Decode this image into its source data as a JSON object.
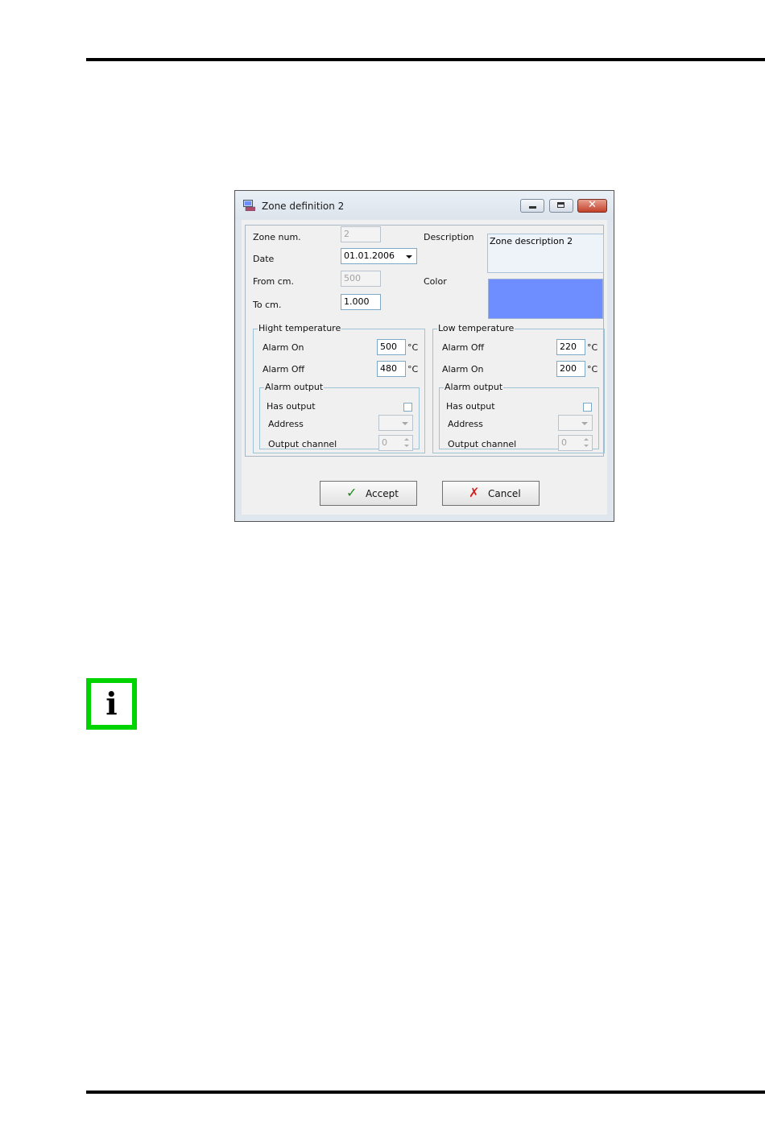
{
  "dialog": {
    "title": "Zone definition 2",
    "close_glyph": "✕",
    "zone_num_label": "Zone num.",
    "zone_num_value": "2",
    "date_label": "Date",
    "date_value": "01.01.2006",
    "from_label": "From cm.",
    "from_value": "500",
    "to_label": "To cm.",
    "to_value": "1.000",
    "description_label": "Description",
    "description_value": "Zone description 2",
    "color_label": "Color",
    "color_value": "#6e8dff",
    "high": {
      "title": "Hight temperature",
      "alarm1_label": "Alarm On",
      "alarm1_value": "500",
      "alarm2_label": "Alarm Off",
      "alarm2_value": "480",
      "unit": "°C",
      "output": {
        "title": "Alarm output",
        "has_output_label": "Has output",
        "address_label": "Address",
        "address_value": "",
        "channel_label": "Output channel",
        "channel_value": "0"
      }
    },
    "low": {
      "title": "Low temperature",
      "alarm1_label": "Alarm Off",
      "alarm1_value": "220",
      "alarm2_label": "Alarm On",
      "alarm2_value": "200",
      "unit": "°C",
      "output": {
        "title": "Alarm output",
        "has_output_label": "Has output",
        "address_label": "Address",
        "address_value": "",
        "channel_label": "Output channel",
        "channel_value": "0"
      }
    },
    "accept_label": "Accept",
    "accept_glyph": "✓",
    "cancel_label": "Cancel",
    "cancel_glyph": "✗"
  },
  "info_icon": {
    "glyph": "i",
    "icon": "info-icon",
    "color": "#00d400"
  }
}
